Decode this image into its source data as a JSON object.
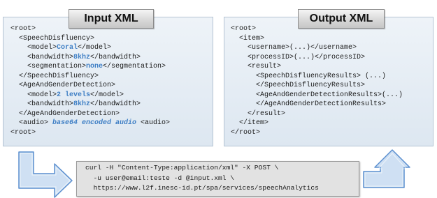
{
  "input": {
    "title": "Input XML",
    "lines": [
      {
        "pre": "<root>"
      },
      {
        "pre": "  <SpeechDisfluency>"
      },
      {
        "pre": "    <model>",
        "val": "Coral",
        "post": "</model>"
      },
      {
        "pre": "    <bandwidth>",
        "val": "8khz",
        "post": "</bandwidth>"
      },
      {
        "pre": "    <segmentation>",
        "val": "none",
        "post": "</segmentation>"
      },
      {
        "pre": "  </SpeechDisfluency>"
      },
      {
        "pre": "  <AgeAndGenderDetection>"
      },
      {
        "pre": "    <model>",
        "val": "2 levels",
        "post": "</model>"
      },
      {
        "pre": "    <bandwidth>",
        "val": "8khz",
        "post": "</bandwidth>"
      },
      {
        "pre": "  </AgeAndGenderDetection>"
      },
      {
        "pre": "  <audio> ",
        "val": "base64 encoded audio",
        "italic": true,
        "post": " <audio>"
      },
      {
        "pre": "<root>"
      }
    ]
  },
  "output": {
    "title": "Output  XML",
    "lines": [
      "<root>",
      "  <item>",
      "    <username>(...)</username>",
      "    <processID>(...)</processID>",
      "    <result>",
      "      <SpeechDisfluencyResults> (...)",
      "      </SpeechDisfluencyResults>",
      "      <AgeAndGenderDetectionResults>(...)",
      "      </AgeAndGenderDetectionResults>",
      "    </result>",
      "  </item>",
      "</root>"
    ]
  },
  "curl": {
    "lines": [
      "curl -H \"Content-Type:application/xml\" -X POST \\",
      "  -u user@email:teste -d @input.xml \\",
      "  https://www.l2f.inesc-id.pt/spa/services/speechAnalytics"
    ]
  },
  "colors": {
    "value_highlight": "#3f7fc5",
    "arrow_fill": "#cfe0f3",
    "arrow_stroke": "#5b8fcf",
    "panel_border": "#b4c3d3"
  }
}
